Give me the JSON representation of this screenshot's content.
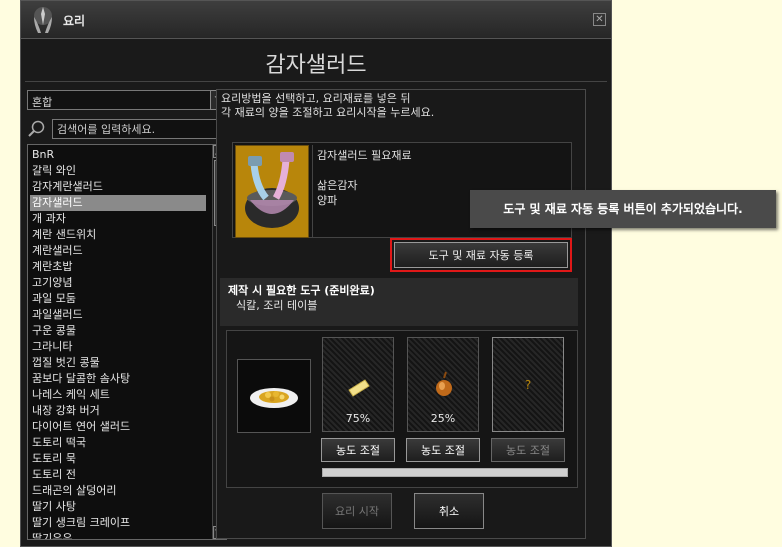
{
  "window": {
    "title": "요리",
    "close_glyph": "✕",
    "dish_title": "감자샐러드"
  },
  "filter": {
    "selected": "혼합",
    "search_placeholder": "검색어를 입력하세요."
  },
  "recipe_list": {
    "selected_index": 3,
    "items": [
      "BnR",
      "갈릭 와인",
      "감자계란샐러드",
      "감자샐러드",
      "개 과자",
      "계란 샌드위치",
      "계란샐러드",
      "계란초밥",
      "고기양념",
      "과일 모둠",
      "과일샐러드",
      "구운 콩물",
      "그라니타",
      "껍질 벗긴 콩물",
      "꿈보다 달콤한 솜사탕",
      "나레스 케익 세트",
      "내장 강화 버거",
      "다이어트 연어 샐러드",
      "도토리 떡국",
      "도토리 묵",
      "도토리 전",
      "드래곤의 살덩어리",
      "딸기 사탕",
      "딸기 생크림 크레이프",
      "딸기우유"
    ]
  },
  "instructions": {
    "line1": "요리방법을 선택하고, 요리재료를 넣은 뒤",
    "line2": "각 재료의 양을 조절하고 요리시작을 누르세요."
  },
  "ingredients": {
    "title": "감자샐러드 필요재료",
    "items": [
      "삶은감자",
      "양파"
    ]
  },
  "auto_register_label": "도구 및 재료 자동 등록",
  "tooltip_text": "도구 및 재료 자동 등록 버튼이 추가되었습니다.",
  "tools": {
    "title": "제작 시 필요한 도구 (준비완료)",
    "list": "식칼, 조리 테이블"
  },
  "slots": [
    {
      "icon": "potato-icon",
      "percent": "75%",
      "button": "농도 조절"
    },
    {
      "icon": "onion-icon",
      "percent": "25%",
      "button": "농도 조절"
    },
    {
      "icon": "question-mark",
      "symbol": "?",
      "button": "농도 조절"
    }
  ],
  "progress": {
    "fraction": 1.0
  },
  "buttons": {
    "start": "요리 시작",
    "cancel": "취소"
  },
  "colors": {
    "highlight_border": "#e01818",
    "tooltip_accent": "#ffd400",
    "selected_row": "#8a8a8a"
  }
}
